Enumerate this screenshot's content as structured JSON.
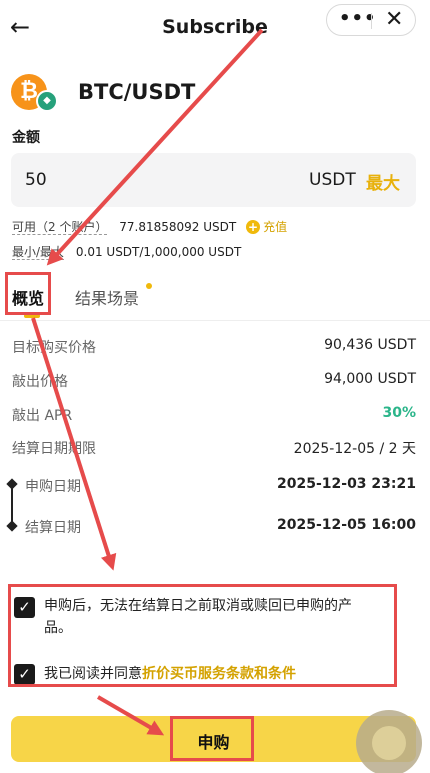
{
  "header": {
    "back_icon": "arrow-left-icon",
    "title": "Subscribe",
    "more_icon": "more-dots-icon",
    "close_icon": "close-icon"
  },
  "asset": {
    "pair": "BTC/USDT",
    "base_icon": "bitcoin-icon",
    "quote_icon": "tether-icon"
  },
  "amount": {
    "label": "金额",
    "value": "50",
    "unit": "USDT",
    "max_label": "最大"
  },
  "available": {
    "label": "可用（2 个账户）",
    "value": "77.81858092 USDT",
    "charge_label": "充值"
  },
  "limits": {
    "label": "最小/最大",
    "value": "0.01 USDT/1,000,000 USDT"
  },
  "tabs": [
    {
      "label": "概览",
      "active": true
    },
    {
      "label": "结果场景",
      "active": false
    }
  ],
  "details": [
    {
      "label": "目标购买价格",
      "value": "90,436 USDT"
    },
    {
      "label": "敲出价格",
      "value": "94,000 USDT"
    },
    {
      "label": "敲出 APR",
      "value": "30%"
    },
    {
      "label": "结算日期期限",
      "value": "2025-12-05 / 2 天"
    }
  ],
  "timeline": [
    {
      "label": "申购日期",
      "value": "2025-12-03 23:21"
    },
    {
      "label": "结算日期",
      "value": "2025-12-05 16:00"
    }
  ],
  "agreements": [
    {
      "text": "申购后，无法在结算日之前取消或赎回已申购的产",
      "text_cont": "品。",
      "checked": true
    },
    {
      "prefix": "我已阅读并同意",
      "link": "折价买币服务条款和条件",
      "checked": true
    }
  ],
  "subscribe_button": "申购",
  "colors": {
    "accent": "#f0b90b",
    "button": "#f7d548",
    "positive": "#2bb58a",
    "annotation": "#e64b4b"
  }
}
